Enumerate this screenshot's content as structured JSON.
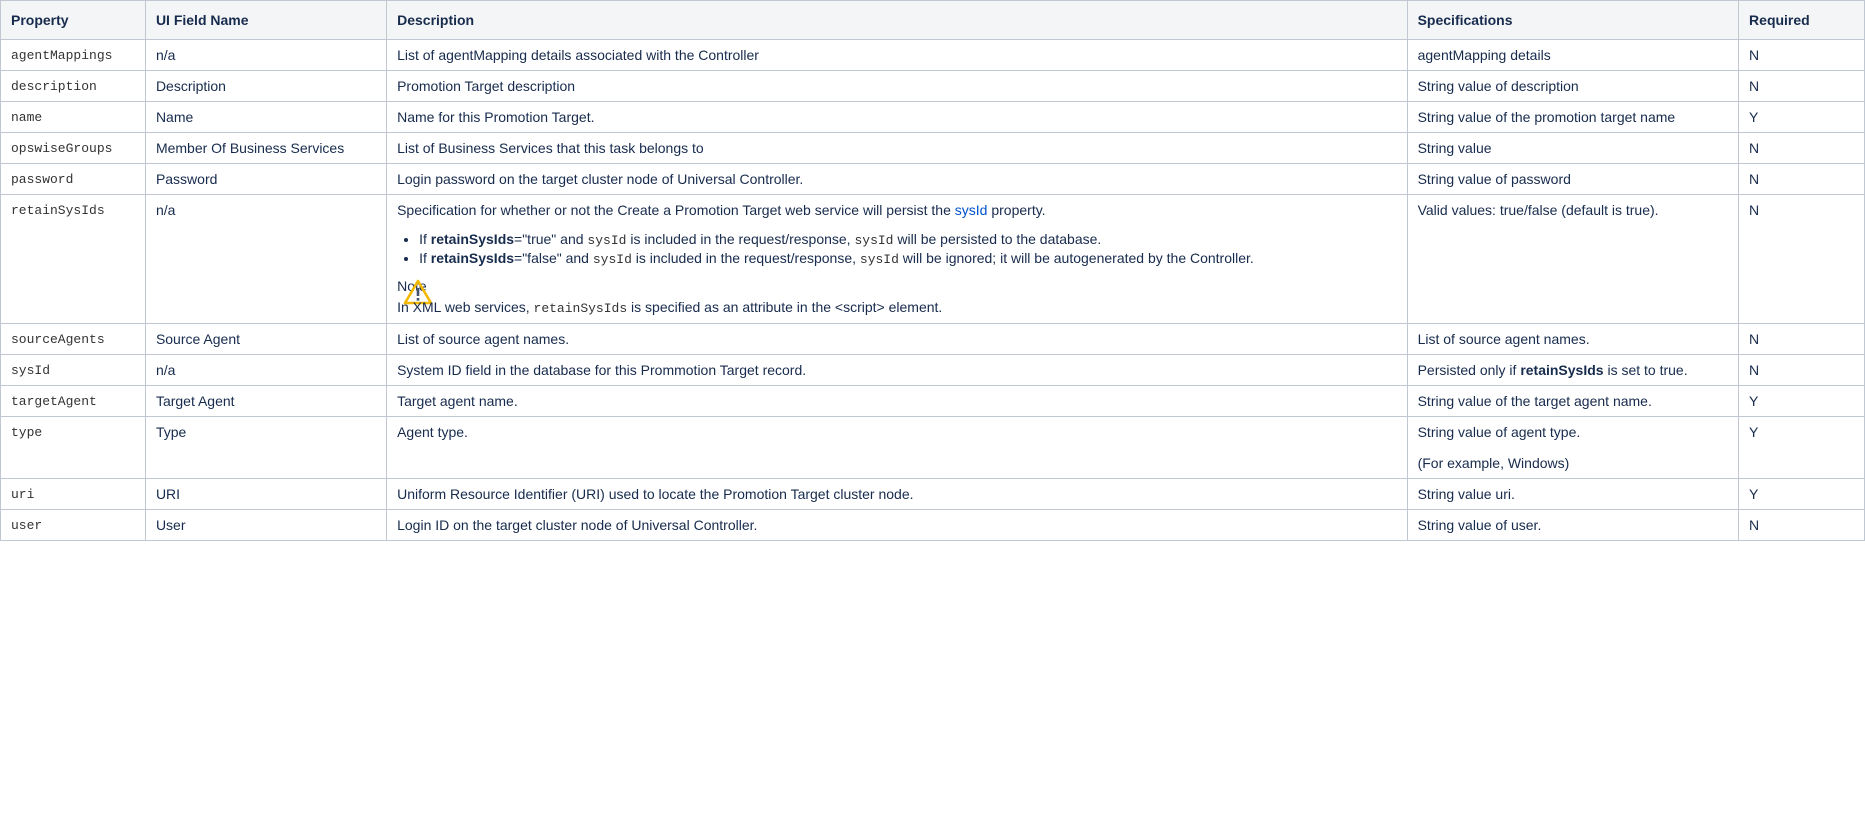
{
  "headers": {
    "property": "Property",
    "ui_field_name": "UI Field Name",
    "description": "Description",
    "specifications": "Specifications",
    "required": "Required"
  },
  "rows": [
    {
      "property": "agentMappings",
      "ui": "n/a",
      "desc": "List of agentMapping details associated with the Controller",
      "spec": "agentMapping details",
      "req": "N"
    },
    {
      "property": "description",
      "ui": "Description",
      "desc": "Promotion Target description",
      "spec": "String value of description",
      "req": "N"
    },
    {
      "property": "name",
      "ui": "Name",
      "desc": "Name for this Promotion Target.",
      "spec": "String value of the promotion target name",
      "req": "Y"
    },
    {
      "property": "opswiseGroups",
      "ui": "Member Of Business Services",
      "desc": "List of Business Services that this task belongs to",
      "spec": "String value",
      "req": "N"
    },
    {
      "property": "password",
      "ui": "Password",
      "desc": "Login password on the target cluster node of Universal Controller.",
      "spec": "String value of password",
      "req": "N"
    },
    {
      "property": "retainSysIds",
      "ui": "n/a",
      "desc_pre": "Specification for whether or not the Create a Promotion Target web service will persist the ",
      "desc_link": "sysId",
      "desc_post": " property.",
      "bullet1": {
        "pre": "If ",
        "bold": "retainSysIds",
        "mid": "=\"true\" and ",
        "code1": "sysId",
        "mid2": " is included in the request/response, ",
        "code2": "sysId",
        "post": " will be persisted to the database."
      },
      "bullet2": {
        "pre": "If ",
        "bold": "retainSysIds",
        "mid": "=\"false\" and ",
        "code1": "sysId",
        "mid2": " is included in the request/response, ",
        "code2": "sysId",
        "post": " will be ignored; it will be autogenerated by the Controller."
      },
      "note_title": "Note",
      "note": {
        "pre": "In XML web services, ",
        "code": "retainSysIds",
        "post": " is specified as an attribute in the <script> element."
      },
      "spec": "Valid values: true/false (default is true).",
      "req": "N"
    },
    {
      "property": "sourceAgents",
      "ui": "Source Agent",
      "desc": "List of source agent names.",
      "spec": "List of source agent names.",
      "req": "N"
    },
    {
      "property": "sysId",
      "ui": "n/a",
      "desc": "System ID field in the database for this Prommotion Target record.",
      "spec_pre": "Persisted only if ",
      "spec_bold": "retainSysIds",
      "spec_post": " is set to true.",
      "req": "N"
    },
    {
      "property": "targetAgent",
      "ui": "Target Agent",
      "desc": "Target agent name.",
      "spec": "String value of the target agent name.",
      "req": "Y"
    },
    {
      "property": "type",
      "ui": "Type",
      "desc": "Agent type.",
      "spec": "String value of agent type.",
      "spec2": "(For example, Windows)",
      "req": "Y"
    },
    {
      "property": "uri",
      "ui": "URI",
      "desc": "Uniform Resource Identifier (URI) used to locate the Promotion Target cluster node.",
      "spec": "String value uri.",
      "req": "Y"
    },
    {
      "property": "user",
      "ui": "User",
      "desc": "Login ID on the target cluster node of Universal Controller.",
      "spec": "String value of user.",
      "req": "N"
    }
  ],
  "colors": {
    "link": "#0052cc",
    "border": "#c1c7d0",
    "header_bg": "#f4f5f7",
    "warning": "#f5b800"
  },
  "icons": {
    "note": "warning-icon"
  }
}
